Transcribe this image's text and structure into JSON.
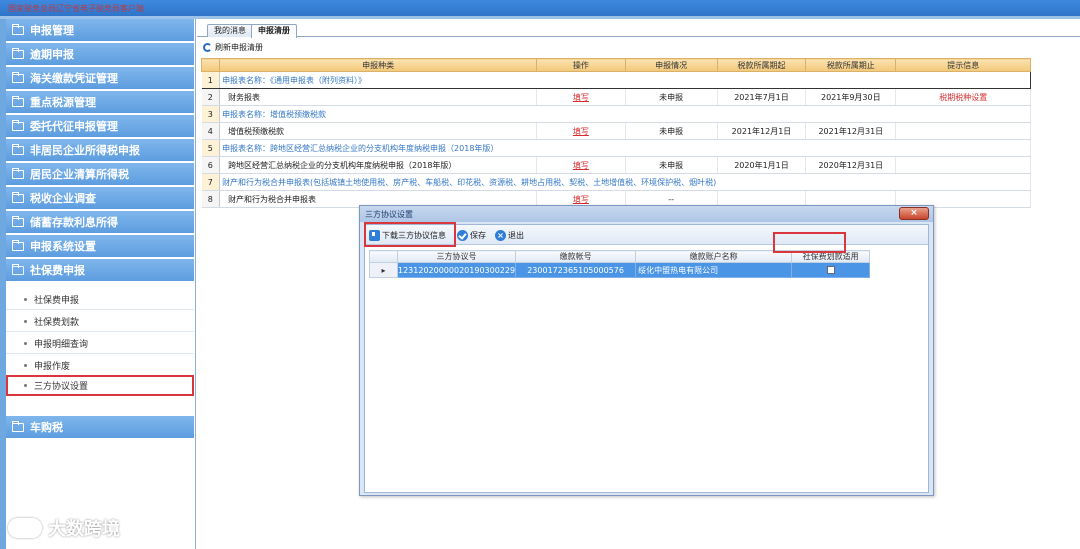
{
  "window": {
    "title": "国家税务总局辽宁省电子税务局客户端"
  },
  "sidebar": {
    "groups": [
      {
        "label": "申报管理"
      },
      {
        "label": "逾期申报"
      },
      {
        "label": "海关缴款凭证管理"
      },
      {
        "label": "重点税源管理"
      },
      {
        "label": "委托代征申报管理"
      },
      {
        "label": "非居民企业所得税申报"
      },
      {
        "label": "居民企业清算所得税"
      },
      {
        "label": "税收企业调查"
      },
      {
        "label": "储蓄存款利息所得"
      },
      {
        "label": "申报系统设置"
      },
      {
        "label": "社保费申报"
      },
      {
        "label": "车购税"
      }
    ],
    "sub_items": [
      {
        "label": "社保费申报"
      },
      {
        "label": "社保费划款"
      },
      {
        "label": "申报明细查询"
      },
      {
        "label": "申报作废"
      },
      {
        "label": "三方协议设置"
      }
    ]
  },
  "tabs": [
    {
      "label": "我的消息"
    },
    {
      "label": "申报清册"
    }
  ],
  "toolbar": {
    "refresh_label": "刷新申报清册"
  },
  "grid": {
    "headers": [
      "申报种类",
      "操作",
      "申报情况",
      "税款所属期起",
      "税款所属期止",
      "提示信息"
    ],
    "rows": [
      {
        "num": "1",
        "group": "申报表名称：《通用申报表（附列资料）》"
      },
      {
        "num": "2",
        "name": "财务报表",
        "op": "填写",
        "status": "未申报",
        "start": "2021年7月1日",
        "end": "2021年9月30日",
        "tip": "税期税种设置"
      },
      {
        "num": "3",
        "group": "申报表名称：增值税预缴税款"
      },
      {
        "num": "4",
        "name": "增值税预缴税款",
        "op": "填写",
        "status": "未申报",
        "start": "2021年12月1日",
        "end": "2021年12月31日",
        "tip": ""
      },
      {
        "num": "5",
        "group": "申报表名称：跨地区经营汇总纳税企业的分支机构年度纳税申报（2018年版）"
      },
      {
        "num": "6",
        "name": "跨地区经营汇总纳税企业的分支机构年度纳税申报（2018年版）",
        "op": "填写",
        "status": "未申报",
        "start": "2020年1月1日",
        "end": "2020年12月31日",
        "tip": ""
      },
      {
        "num": "7",
        "group": "财产和行为税合并申报表(包括城镇土地使用税、房产税、车船税、印花税、资源税、耕地占用税、契税、土地增值税、环境保护税、烟叶税)"
      },
      {
        "num": "8",
        "name": "财产和行为税合并申报表",
        "op": "填写",
        "status": "--",
        "start": "",
        "end": "",
        "tip": ""
      }
    ]
  },
  "dialog": {
    "title": "三方协议设置",
    "close": "×",
    "buttons": {
      "download": "下载三方协议信息",
      "save": "保存",
      "exit": "退出"
    },
    "headers": [
      "三方协议号",
      "缴款帐号",
      "缴款账户名称",
      "社保费划款适用"
    ],
    "row": {
      "marker": "▸",
      "agreement_no": "12312020000020190300229",
      "account_no": "2300172365105000576",
      "account_name": "绥化中盟热电有限公司"
    }
  },
  "watermark": {
    "text": "大数跨境"
  }
}
